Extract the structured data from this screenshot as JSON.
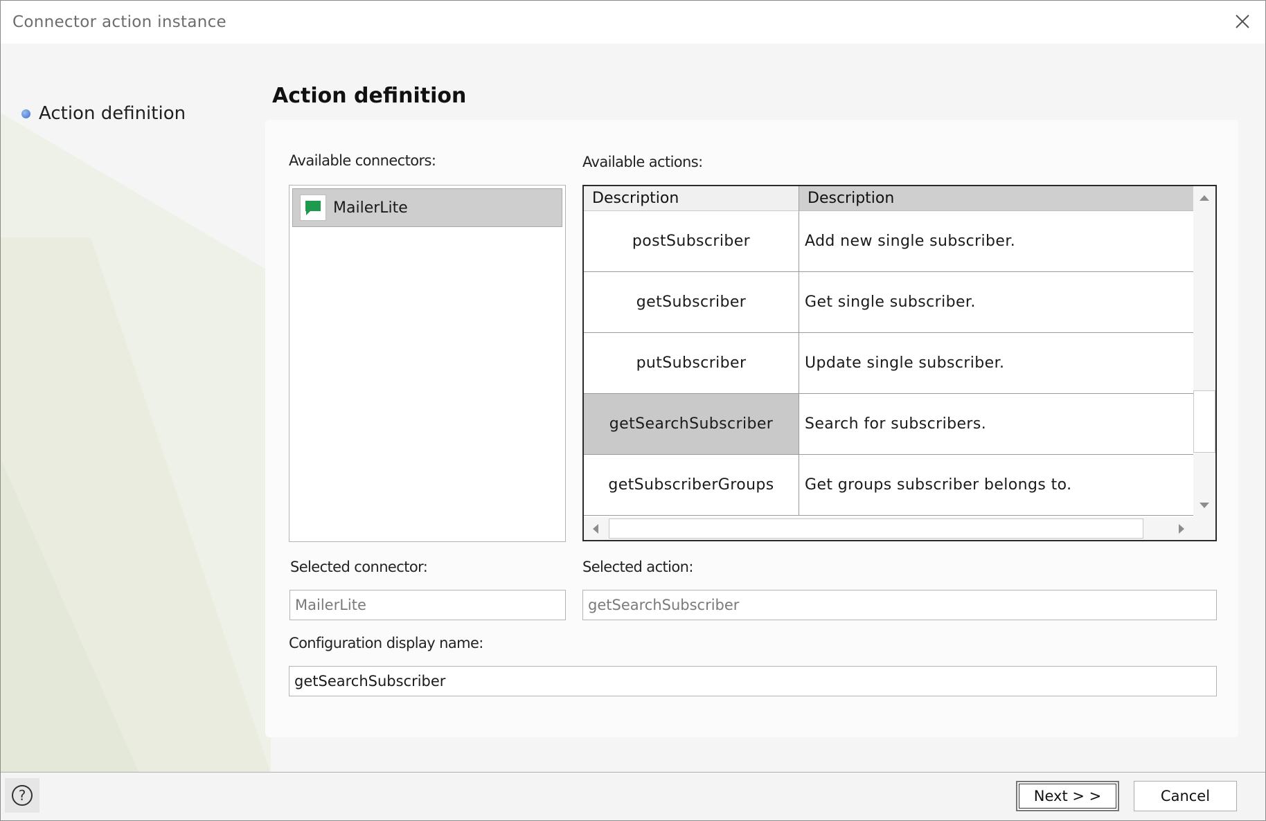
{
  "window": {
    "title": "Connector action instance"
  },
  "nav": {
    "steps": [
      {
        "label": "Action definition"
      }
    ]
  },
  "page": {
    "title": "Action definition"
  },
  "connectors": {
    "label": "Available connectors:",
    "items": [
      {
        "label": "MailerLite",
        "icon": "chat-bubble-icon",
        "color": "#1e9a4f"
      }
    ]
  },
  "actions": {
    "label": "Available actions:",
    "columns": [
      "Description",
      "Description"
    ],
    "rows": [
      {
        "name": "postSubscriber",
        "description": "Add new single subscriber."
      },
      {
        "name": "getSubscriber",
        "description": "Get single subscriber."
      },
      {
        "name": "putSubscriber",
        "description": "Update single subscriber."
      },
      {
        "name": "getSearchSubscriber",
        "description": "Search for subscribers."
      },
      {
        "name": "getSubscriberGroups",
        "description": "Get groups subscriber belongs to."
      }
    ]
  },
  "selected_connector": {
    "label": "Selected connector:",
    "value": "MailerLite"
  },
  "selected_action": {
    "label": "Selected action:",
    "value": "getSearchSubscriber"
  },
  "config": {
    "label": "Configuration display name:",
    "value": "getSearchSubscriber"
  },
  "footer": {
    "help": "?",
    "next_label": "Next > >",
    "cancel_label": "Cancel"
  }
}
